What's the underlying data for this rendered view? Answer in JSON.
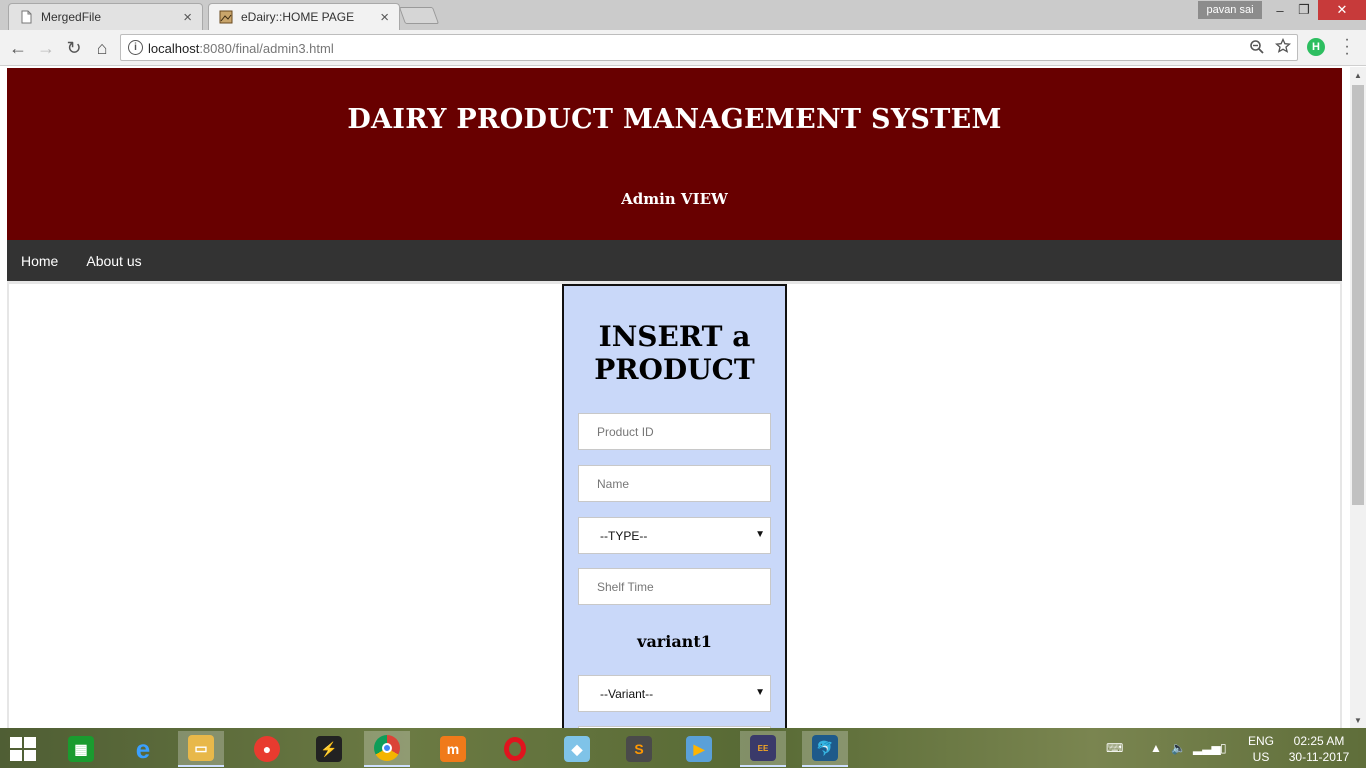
{
  "browser": {
    "tabs": [
      {
        "title": "MergedFile",
        "close": "×"
      },
      {
        "title": "eDairy::HOME PAGE",
        "close": "×"
      }
    ],
    "profile": "pavan sai",
    "window_controls": {
      "minimize": "–",
      "restore": "❐",
      "close": "✕"
    },
    "nav": {
      "back": "←",
      "forward": "→",
      "reload": "↻",
      "home": "⌂"
    },
    "url_host": "localhost",
    "url_path": ":8080/final/admin3.html",
    "extension_badge": "H"
  },
  "site": {
    "title": "DAIRY PRODUCT MANAGEMENT SYSTEM",
    "subtitle": "Admin VIEW",
    "header_color": "#680000",
    "nav_links": [
      "Home",
      "About us"
    ]
  },
  "form": {
    "heading_line1": "INSERT a",
    "heading_line2": "PRODUCT",
    "product_id_placeholder": "Product ID",
    "name_placeholder": "Name",
    "type_selected": "--TYPE--",
    "shelf_time_placeholder": "Shelf Time",
    "variant_label": "variant1",
    "variant_selected": "--Variant--",
    "panel_color": "#c9d8f9"
  },
  "taskbar": {
    "icons": [
      "store-icon",
      "internet-explorer-icon",
      "file-explorer-icon",
      "record-app-icon",
      "winamp-icon",
      "chrome-icon",
      "micromax-icon",
      "opera-icon",
      "photos-icon",
      "sublime-text-icon",
      "video-player-icon",
      "java-ee-ide-icon",
      "mysql-workbench-icon"
    ],
    "language": "ENG",
    "region": "US",
    "time": "02:25 AM",
    "date": "30-11-2017"
  }
}
